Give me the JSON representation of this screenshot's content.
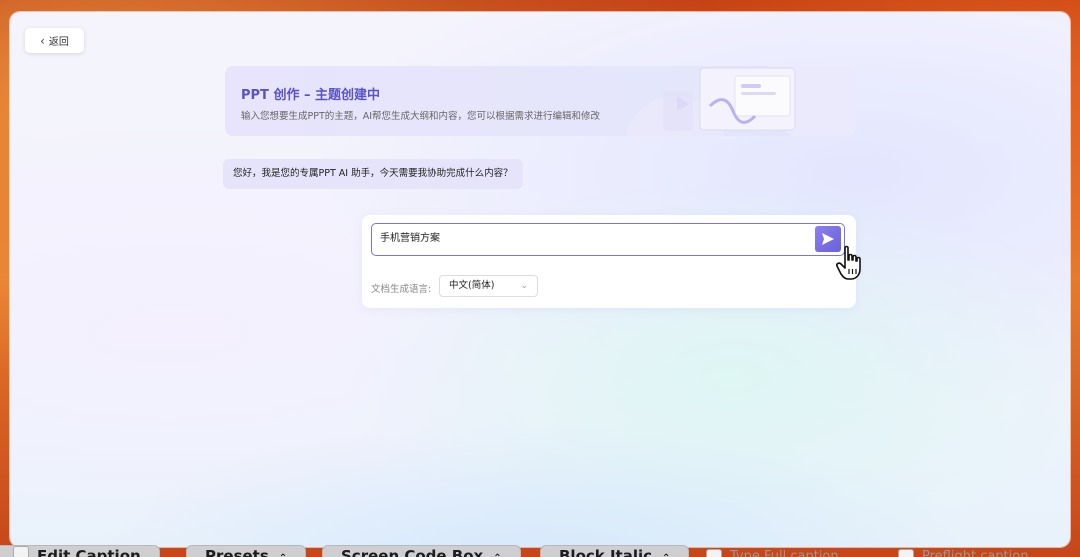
{
  "nav": {
    "back_label": "返回"
  },
  "banner": {
    "title": "PPT 创作 – 主题创建中",
    "subtitle": "输入您想要生成PPT的主题，AI帮您生成大纲和内容，您可以根据需求进行编辑和修改"
  },
  "chat": {
    "greeting": "您好，我是您的专属PPT AI 助手，今天需要我协助完成什么内容？"
  },
  "input": {
    "value": "手机营销方案",
    "language_label": "文档生成语言:",
    "language_value": "中文(简体)"
  },
  "bottom_toolbar": {
    "items": [
      "Edit Caption",
      "Presets",
      "Screen Code Box",
      "Block Italic"
    ],
    "checks": [
      "Type Full caption",
      "Preflight caption"
    ]
  },
  "icons": {
    "back": "chevron-left-icon",
    "send": "send-icon",
    "cursor": "hand-pointer-icon",
    "dropdown": "chevron-down-icon"
  },
  "colors": {
    "accent": "#6a60d8",
    "banner_title": "#5a52c8",
    "greeting_bg": "#e5e4fa"
  }
}
